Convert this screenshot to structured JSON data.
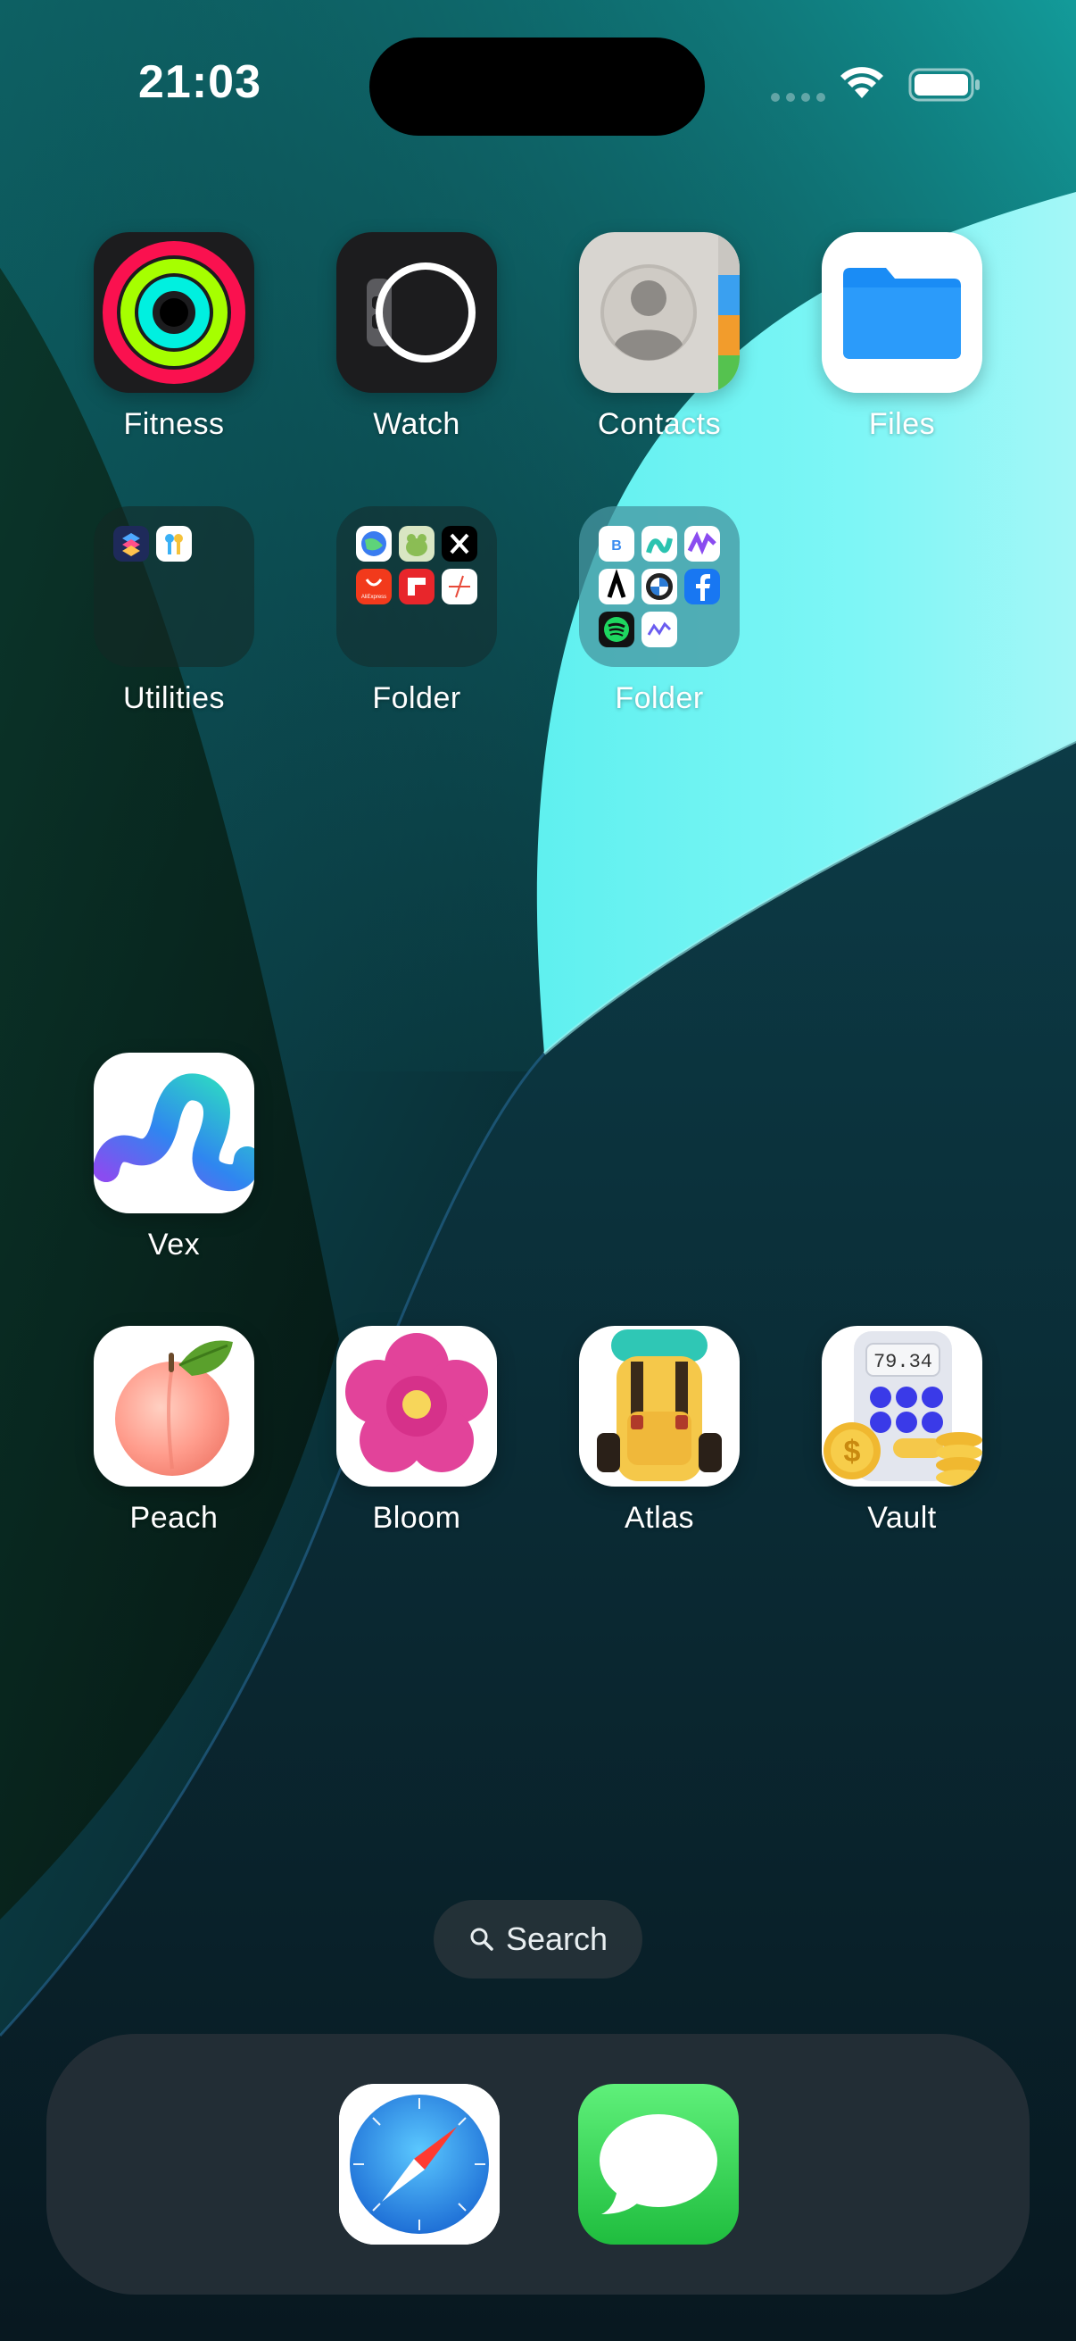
{
  "status_bar": {
    "time": "21:03",
    "wifi_icon": "wifi-icon",
    "battery_icon": "battery-icon",
    "signal_icon": "cellular-signal-icon"
  },
  "home_screen": {
    "row1": [
      {
        "label": "Fitness",
        "icon": "activity-rings-icon"
      },
      {
        "label": "Watch",
        "icon": "apple-watch-icon"
      },
      {
        "label": "Contacts",
        "icon": "contacts-icon"
      },
      {
        "label": "Files",
        "icon": "folder-icon"
      }
    ],
    "row2": [
      {
        "label": "Utilities",
        "icon": "utilities-folder-icon"
      },
      {
        "label": "Folder",
        "icon": "app-folder-icon"
      },
      {
        "label": "Folder",
        "icon": "app-folder-icon"
      }
    ],
    "row3": [
      {
        "label": "Vex",
        "icon": "vex-swirl-icon"
      }
    ],
    "row4": [
      {
        "label": "Peach",
        "icon": "peach-icon"
      },
      {
        "label": "Bloom",
        "icon": "flower-icon"
      },
      {
        "label": "Atlas",
        "icon": "backpack-icon"
      },
      {
        "label": "Vault",
        "icon": "calculator-coins-icon"
      }
    ],
    "vault_display": "79.34",
    "mini_labels": {
      "aliexpress": "AliExpress"
    }
  },
  "search": {
    "label": "Search",
    "icon": "search-icon"
  },
  "dock": {
    "apps": [
      {
        "name": "Safari",
        "icon": "safari-compass-icon"
      },
      {
        "name": "Messages",
        "icon": "messages-bubble-icon"
      }
    ]
  },
  "colors": {
    "fitness_red": "#fa114f",
    "fitness_green": "#a6ff00",
    "fitness_cyan": "#00f0e0",
    "files_blue": "#1a8cf5",
    "messages_green": "#2fd158",
    "safari_blue": "#1e88e5",
    "wallpaper_cyan": "#7ef6f6",
    "wallpaper_teal": "#0f8f92"
  }
}
